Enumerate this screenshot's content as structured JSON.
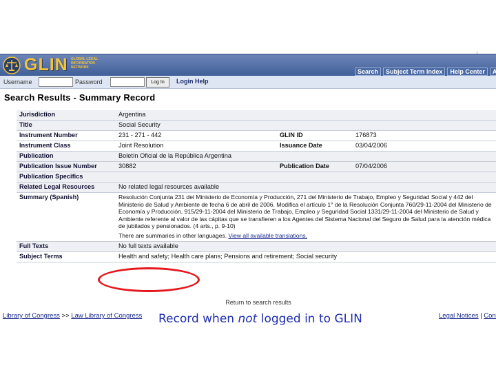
{
  "header": {
    "logo_text": "GLIN",
    "logo_sub": "GLOBAL LEGAL INFORMATION NETWORK",
    "nav": [
      "Search",
      "Subject Term Index",
      "Help Center",
      "About"
    ]
  },
  "login": {
    "username_label": "Username",
    "password_label": "Password",
    "login_button": "Log In",
    "help_link": "Login Help"
  },
  "page_title": "Search Results - Summary Record",
  "record": {
    "jurisdiction_label": "Jurisdiction",
    "jurisdiction": "Argentina",
    "title_label": "Title",
    "title": "Social Security",
    "instrument_number_label": "Instrument Number",
    "instrument_number": "231 - 271 - 442",
    "glin_id_label": "GLIN ID",
    "glin_id": "176873",
    "instrument_class_label": "Instrument Class",
    "instrument_class": "Joint Resolution",
    "issuance_date_label": "Issuance Date",
    "issuance_date": "03/04/2006",
    "publication_label": "Publication",
    "publication": "Boletín Oficial de la República Argentina",
    "issue_number_label": "Publication Issue Number",
    "issue_number": "30882",
    "publication_date_label": "Publication Date",
    "publication_date": "07/04/2006",
    "specifics_label": "Publication Specifics",
    "related_label": "Related Legal Resources",
    "related": "No related legal resources available",
    "summary_label": "Summary (Spanish)",
    "summary": "Resolución Conjunta 231 del Ministerio de Economía y Producción, 271 del Ministerio de Trabajo, Empleo y Seguridad Social y 442 del Ministerio de Salud y Ambiente de fecha 6 de abril de 2006. Modifica el artículo 1° de la Resolución Conjunta 760/29-11-2004 del Ministerio de Economía y Producción, 915/29-11-2004 del Ministerio de Trabajo, Empleo y Seguridad Social 1331/29-11-2004 del Ministerio de Salud y Ambiente referente al valor de las cápitas que se transfieren a los Agentes del Sistema Nacional del Seguro de Salud para la atención médica de jubilados y pensionados. (4 arts., p. 9-10)",
    "other_languages": "There are summaries in other languages.",
    "translations_link": "View all available translations.",
    "full_texts_label": "Full Texts",
    "full_texts": "No full texts available",
    "subject_terms_label": "Subject Terms",
    "subject_terms": "Health and safety; Health care plans; Pensions and retirement; Social security"
  },
  "return_link": "Return to search results",
  "footer": {
    "left1": "Library of Congress",
    "sep": " >> ",
    "left2": "Law Library of Congress",
    "right1": "Legal Notices",
    "right_sep": " | ",
    "right2": "Contact"
  },
  "caption": {
    "before": "Record when ",
    "emph": "not",
    "after": " logged in to GLIN"
  }
}
